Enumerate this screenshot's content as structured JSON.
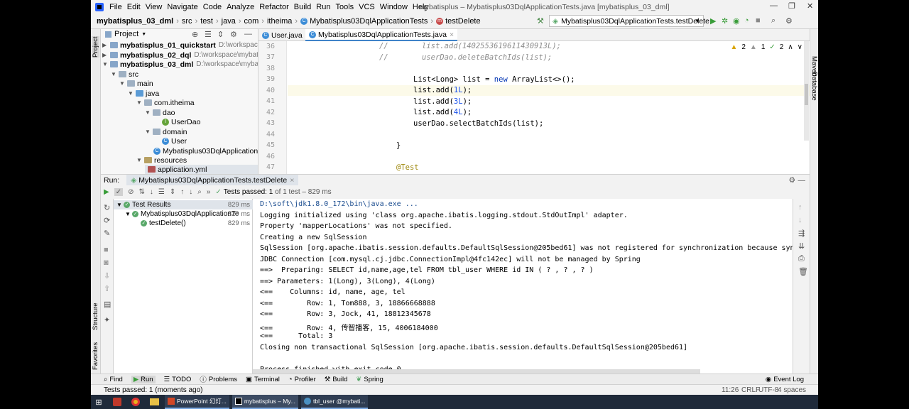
{
  "menu": {
    "items": [
      "File",
      "Edit",
      "View",
      "Navigate",
      "Code",
      "Analyze",
      "Refactor",
      "Build",
      "Run",
      "Tools",
      "VCS",
      "Window",
      "Help"
    ],
    "window_title": "mybatisplus – Mybatisplus03DqlApplicationTests.java [mybatisplus_03_dml]"
  },
  "breadcrumbs": [
    "mybatisplus_03_dml",
    "src",
    "test",
    "java",
    "com",
    "itheima",
    "Mybatisplus03DqlApplicationTests",
    "testDelete"
  ],
  "run_config": "Mybatisplus03DqlApplicationTests.testDelete",
  "project": {
    "title": "Project",
    "tree": [
      {
        "label": "mybatisplus_01_quickstart",
        "path": "D:\\workspace\\mybatisplus",
        "bold": true
      },
      {
        "label": "mybatisplus_02_dql",
        "path": "D:\\workspace\\mybatisplus",
        "bold": true
      },
      {
        "label": "mybatisplus_03_dml",
        "path": "D:\\workspace\\mybatisplus",
        "bold": true
      },
      {
        "label": "src"
      },
      {
        "label": "main"
      },
      {
        "label": "java"
      },
      {
        "label": "com.itheima"
      },
      {
        "label": "dao"
      },
      {
        "label": "UserDao"
      },
      {
        "label": "domain"
      },
      {
        "label": "User"
      },
      {
        "label": "Mybatisplus03DqlApplication"
      },
      {
        "label": "resources"
      },
      {
        "label": "application.yml"
      }
    ]
  },
  "editor": {
    "tabs": [
      "User.java",
      "Mybatisplus03DqlApplicationTests.java"
    ],
    "inspections": {
      "warn": "2",
      "weak": "1",
      "typo": "2"
    },
    "line_numbers": [
      "36",
      "37",
      "38",
      "39",
      "40",
      "41",
      "42",
      "43",
      "44",
      "45",
      "46",
      "47"
    ],
    "lines": {
      "l36a": "//",
      "l36b": "list.add(1402553619611430913L);",
      "l37a": "//",
      "l37b": "userDao.deleteBatchIds(list);",
      "l39a": "List<Long> list = ",
      "l39b": "new",
      "l39c": " ArrayList<>();",
      "l40a": "list.add(",
      "l40b": "1L",
      "l40c": ");",
      "l41a": "list.add(",
      "l41b": "3L",
      "l41c": ");",
      "l42a": "list.add(",
      "l42b": "4L",
      "l42c": ");",
      "l43": "userDao.selectBatchIds(list);",
      "l45": "}",
      "l47": "@Test"
    }
  },
  "run": {
    "label": "Run:",
    "tab": "Mybatisplus03DqlApplicationTests.testDelete",
    "status_prefix": "Tests passed:",
    "status_count": "1",
    "status_suffix": "of 1 test – 829 ms",
    "tree": [
      {
        "label": "Test Results",
        "time": "829 ms"
      },
      {
        "label": "Mybatisplus03DqlApplicationTe",
        "time": "829 ms"
      },
      {
        "label": "testDelete()",
        "time": "829 ms"
      }
    ],
    "console": [
      "D:\\soft\\jdk1.8.0_172\\bin\\java.exe ...",
      "Logging initialized using 'class org.apache.ibatis.logging.stdout.StdOutImpl' adapter.",
      "Property 'mapperLocations' was not specified.",
      "Creating a new SqlSession",
      "SqlSession [org.apache.ibatis.session.defaults.DefaultSqlSession@205bed61] was not registered for synchronization because synchr",
      "JDBC Connection [com.mysql.cj.jdbc.ConnectionImpl@4fc142ec] will not be managed by Spring",
      "==>  Preparing: SELECT id,name,age,tel FROM tbl_user WHERE id IN ( ? , ? , ? )",
      "==> Parameters: 1(Long), 3(Long), 4(Long)",
      "<==    Columns: id, name, age, tel",
      "<==        Row: 1, Tom888, 3, 18866668888",
      "<==        Row: 3, Jock, 41, 18812345678",
      "<==        Row: 4, 传智播客, 15, 4006184000",
      "<==      Total: 3",
      "Closing non transactional SqlSession [org.apache.ibatis.session.defaults.DefaultSqlSession@205bed61]",
      "",
      "Process finished with exit code 0"
    ]
  },
  "bottom_tabs": [
    "Find",
    "Run",
    "TODO",
    "Problems",
    "Terminal",
    "Profiler",
    "Build",
    "Spring"
  ],
  "event_log": "Event Log",
  "status": {
    "message": "Tests passed: 1 (moments ago)",
    "position": "11:26",
    "line_sep": "CRLF",
    "encoding": "UTF-8",
    "indent": "4 spaces"
  },
  "side_tabs": {
    "left_top": "Project",
    "left_mid": "Structure",
    "left_bottom": "Favorites",
    "right_top": "Maven",
    "right_mid": "Database"
  },
  "taskbar": {
    "ppt": "PowerPoint 幻灯...",
    "idea": "mybatisplus – My...",
    "db": "tbl_user @mybati..."
  }
}
